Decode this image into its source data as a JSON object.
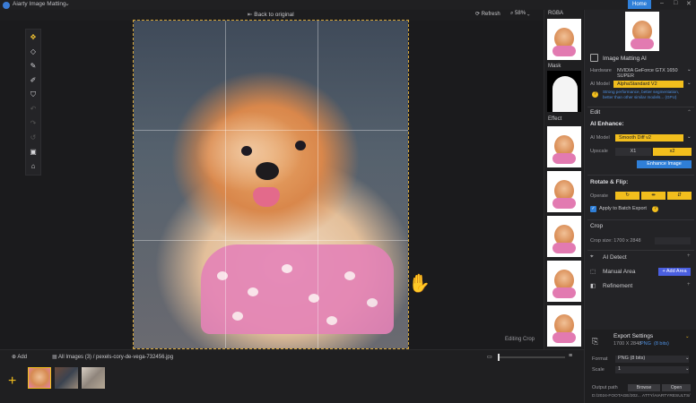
{
  "app": {
    "name": "Aiarty Image Matting",
    "home_label": "Home"
  },
  "canvas_toolbar": {
    "back_label": "Back to original",
    "refresh_label": "Refresh",
    "zoom_value": "58%"
  },
  "thumbs": {
    "rgba_label": "RGBA",
    "mask_label": "Mask",
    "effect_label": "Effect"
  },
  "panel": {
    "title": "Image Matting AI",
    "hardware_label": "Hardware",
    "hardware_value": "NVIDIA GeForce GTX 1650 SUPER",
    "ai_model_label": "AI Model",
    "ai_model_value": "AlphaStandard  V2",
    "model_note": "Strong performance, better segmentation, better than other similar models... (GPU)",
    "edit_title": "Edit",
    "ai_enhance_title": "AI Enhance:",
    "enhance_model_label": "AI Model",
    "enhance_model_value": "Smooth Diff v2",
    "upscale_label": "Upscale",
    "upscale_x1": "X1",
    "upscale_x2": "x2",
    "enhance_button": "Enhance Image",
    "rotate_title": "Rotate & Flip:",
    "operate_label": "Operate",
    "batch_label": "Apply to Batch Export",
    "crop_title": "Crop",
    "crop_size": "Crop size: 1700 x 2848",
    "ai_detect_label": "AI Detect",
    "manual_area_label": "Manual Area",
    "add_area_label": "+ Add Area",
    "refinement_label": "Refinement",
    "export_title": "Export Settings",
    "export_size": "1700 X 2848",
    "export_format_tag": "PNG",
    "export_bits_tag": "(8 bits)",
    "format_label": "Format",
    "format_value": "PNG   (8 bits)",
    "scale_label": "Scale",
    "scale_value": "1",
    "output_label": "Output path",
    "browse_label": "Browse",
    "open_label": "Open",
    "output_path": "D:/2024-FOOTAGE/202... ATTY/AIARTYRESULTS/"
  },
  "canvas": {
    "mode_label": "Editing Crop"
  },
  "bottom": {
    "add_label": "Add",
    "all_images": "All Images (3)",
    "separator": "/",
    "filename": "pexels-cory-de-vega-732456.jpg"
  },
  "colors": {
    "accent": "#f2be1d",
    "primary": "#2f7fd8",
    "harness": "#e483b7"
  }
}
